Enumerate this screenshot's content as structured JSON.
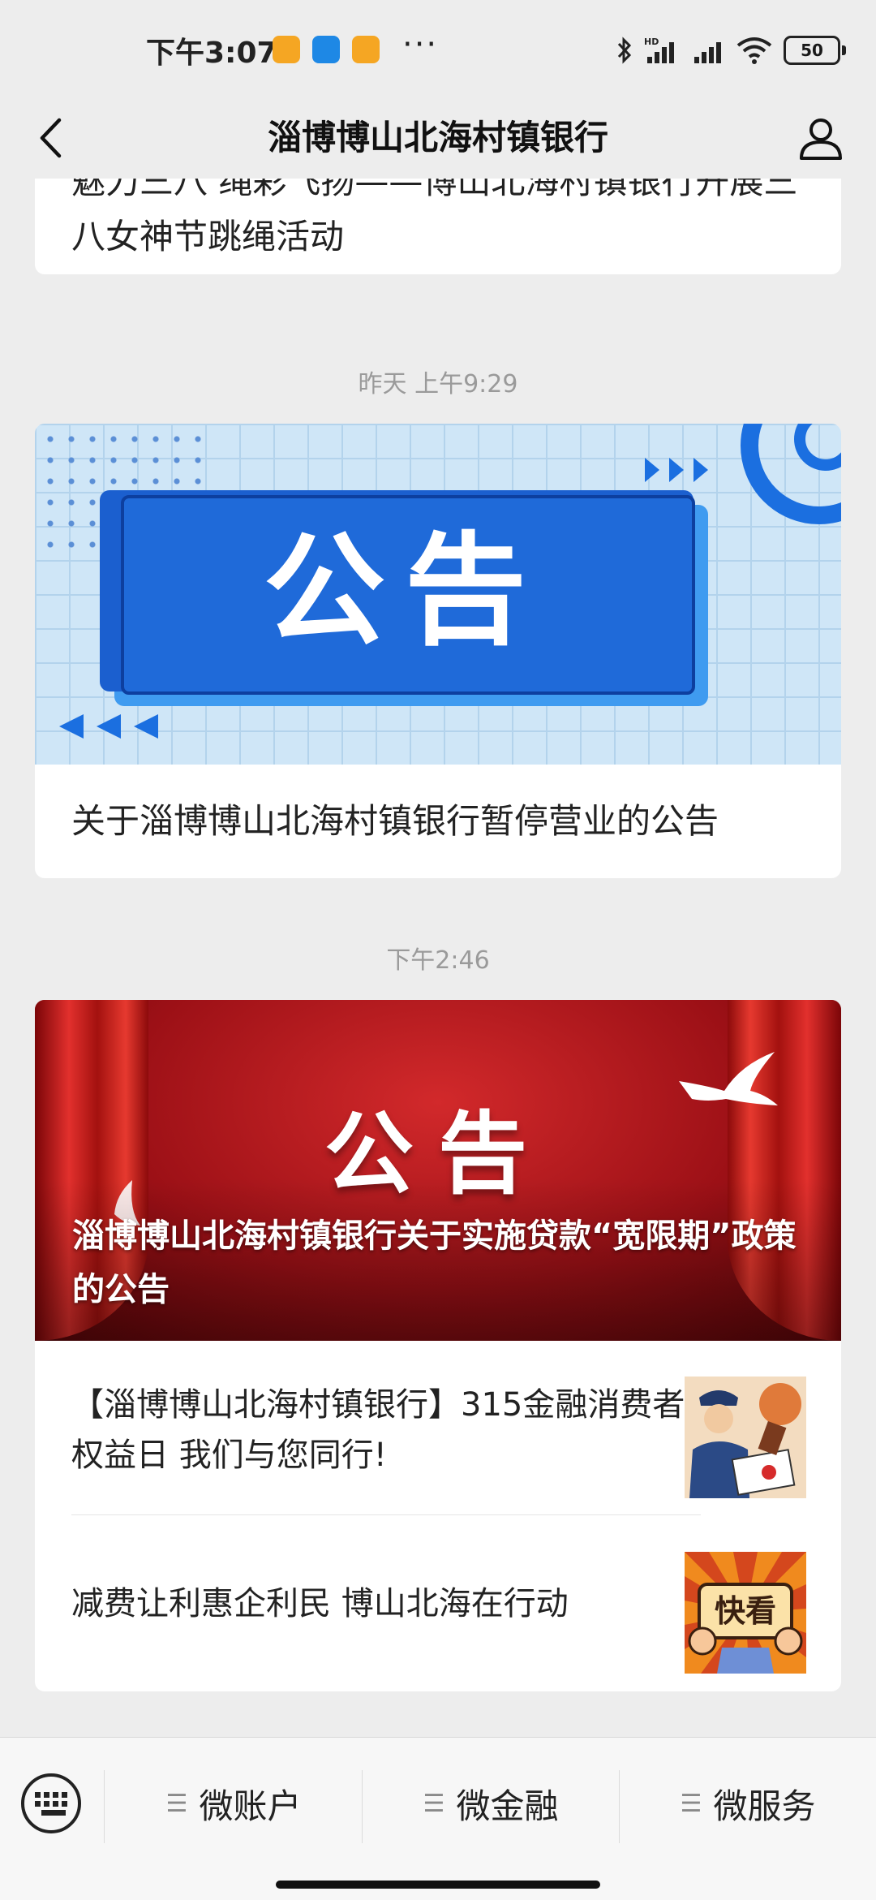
{
  "status_bar": {
    "time": "下午3:07",
    "app_icons": [
      {
        "name": "orange-app-icon",
        "color": "#f5a623"
      },
      {
        "name": "blue-app-icon",
        "color": "#1e88e5"
      },
      {
        "name": "orange-app-icon",
        "color": "#f5a623"
      }
    ],
    "more": "···",
    "network_label": "HD",
    "battery": "50"
  },
  "nav": {
    "title": "淄博博山北海村镇银行",
    "back_icon": "chevron-left-icon",
    "profile_icon": "person-icon"
  },
  "feed": {
    "prev_article_title": "魅力三八 绳彩飞扬——博山北海村镇银行开展三八女神节跳绳活动",
    "timestamp_1": "昨天 上午9:29",
    "notice1": {
      "cover_text": "公告",
      "title": "关于淄博博山北海村镇银行暂停营业的公告"
    },
    "timestamp_2": "下午2:46",
    "notice2": {
      "cover_text": "公告",
      "title": "淄博博山北海村镇银行关于实施贷款“宽限期”政策的公告"
    },
    "items": [
      {
        "title": "【淄博博山北海村镇银行】315金融消费者权益日 我们与您同行!",
        "thumb": "police-stamp-illustration"
      },
      {
        "title": "减费让利惠企利民 博山北海在行动",
        "thumb_text": "快看"
      }
    ]
  },
  "bottom_bar": {
    "keyboard_icon": "keyboard-icon",
    "menus": [
      {
        "label": "微账户",
        "icon": "menu-lines-icon"
      },
      {
        "label": "微金融",
        "icon": "menu-lines-icon"
      },
      {
        "label": "微服务",
        "icon": "menu-lines-icon"
      }
    ]
  },
  "colors": {
    "background": "#ededed",
    "card": "#ffffff",
    "notice_blue": "#1f6ad9",
    "notice_red": "#b5161b",
    "timestamp": "#9a9a9a"
  }
}
